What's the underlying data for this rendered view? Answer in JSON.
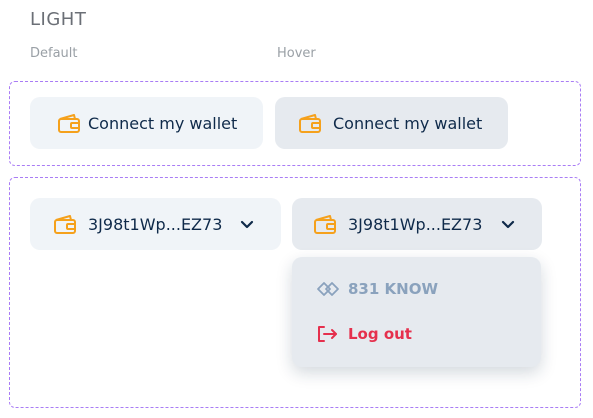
{
  "section": {
    "title": "LIGHT"
  },
  "states": {
    "default_label": "Default",
    "hover_label": "Hover"
  },
  "connect": {
    "label": "Connect my wallet",
    "icon": "wallet-icon"
  },
  "address": {
    "label": "3J98t1Wp...EZ73",
    "icon": "wallet-icon",
    "chevron": "chevron-down-icon"
  },
  "dropdown": {
    "balance": {
      "text": "831 KNOW",
      "icon": "token-diamond-icon"
    },
    "logout": {
      "text": "Log out",
      "icon": "logout-arrow-icon"
    }
  },
  "colors": {
    "accent_orange": "#f5a11c",
    "text_navy": "#0f2a4a",
    "button_bg": "#f0f4f8",
    "button_hover_bg": "#e6eaef",
    "frame_dashed": "#a97cf5",
    "logout_red": "#e5304d",
    "balance_gray": "#8aa2bd"
  }
}
